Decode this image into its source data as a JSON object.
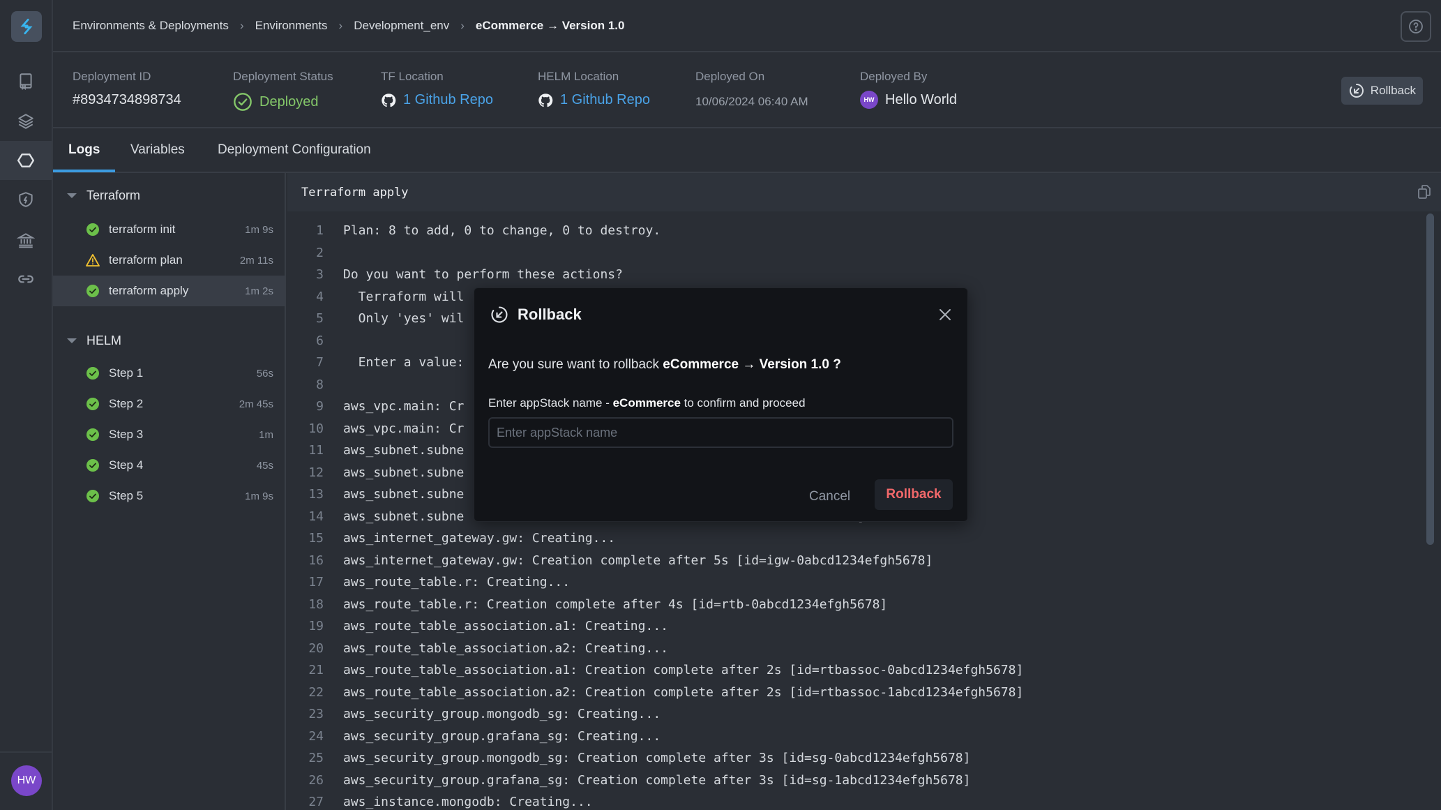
{
  "rail": {
    "items": [
      {
        "name": "book-icon"
      },
      {
        "name": "layers-icon"
      },
      {
        "name": "hexagon-icon",
        "active": true
      },
      {
        "name": "shield-bolt-icon"
      },
      {
        "name": "bank-icon"
      },
      {
        "name": "link-icon"
      }
    ],
    "avatar_initials": "HW"
  },
  "breadcrumb": {
    "items": [
      "Environments & Deployments",
      "Environments",
      "Development_env",
      "eCommerce → Version 1.0"
    ]
  },
  "info": {
    "deployment_id": {
      "label": "Deployment ID",
      "value": "#8934734898734"
    },
    "status": {
      "label": "Deployment Status",
      "value": "Deployed"
    },
    "tf_location": {
      "label": "TF Location",
      "value": "1 Github Repo"
    },
    "helm_location": {
      "label": "HELM Location",
      "value": "1 Github Repo"
    },
    "deployed_on": {
      "label": "Deployed On",
      "value": "10/06/2024 06:40 AM"
    },
    "deployed_by": {
      "label": "Deployed By",
      "value": "Hello World",
      "initials": "HW"
    },
    "rollback_label": "Rollback"
  },
  "tabs": [
    {
      "label": "Logs",
      "active": true
    },
    {
      "label": "Variables"
    },
    {
      "label": "Deployment Configuration"
    }
  ],
  "steps": {
    "terraform": {
      "title": "Terraform",
      "items": [
        {
          "name": "terraform init",
          "duration": "1m 9s",
          "status": "success"
        },
        {
          "name": "terraform plan",
          "duration": "2m 11s",
          "status": "warning"
        },
        {
          "name": "terraform apply",
          "duration": "1m 2s",
          "status": "success",
          "active": true
        }
      ]
    },
    "helm": {
      "title": "HELM",
      "items": [
        {
          "name": "Step 1",
          "duration": "56s",
          "status": "success"
        },
        {
          "name": "Step 2",
          "duration": "2m 45s",
          "status": "success"
        },
        {
          "name": "Step 3",
          "duration": "1m",
          "status": "success"
        },
        {
          "name": "Step 4",
          "duration": "45s",
          "status": "success"
        },
        {
          "name": "Step 5",
          "duration": "1m 9s",
          "status": "success"
        }
      ]
    }
  },
  "log": {
    "title": "Terraform apply",
    "lines": [
      "Plan: 8 to add, 0 to change, 0 to destroy.",
      "",
      "Do you want to perform these actions?",
      "  Terraform will",
      "  Only 'yes' wil",
      "",
      "  Enter a value:",
      "",
      "aws_vpc.main: Cr",
      "aws_vpc.main: Cr",
      "aws_subnet.subne",
      "aws_subnet.subne",
      "aws_subnet.subne",
      "aws_subnet.subne                                                    ]",
      "aws_internet_gateway.gw: Creating...",
      "aws_internet_gateway.gw: Creation complete after 5s [id=igw-0abcd1234efgh5678]",
      "aws_route_table.r: Creating...",
      "aws_route_table.r: Creation complete after 4s [id=rtb-0abcd1234efgh5678]",
      "aws_route_table_association.a1: Creating...",
      "aws_route_table_association.a2: Creating...",
      "aws_route_table_association.a1: Creation complete after 2s [id=rtbassoc-0abcd1234efgh5678]",
      "aws_route_table_association.a2: Creation complete after 2s [id=rtbassoc-1abcd1234efgh5678]",
      "aws_security_group.mongodb_sg: Creating...",
      "aws_security_group.grafana_sg: Creating...",
      "aws_security_group.mongodb_sg: Creation complete after 3s [id=sg-0abcd1234efgh5678]",
      "aws_security_group.grafana_sg: Creation complete after 3s [id=sg-1abcd1234efgh5678]",
      "aws_instance.mongodb: Creating..."
    ]
  },
  "modal": {
    "title": "Rollback",
    "question_prefix": "Are you sure want to rollback ",
    "question_app": "eCommerce",
    "question_arrow": " → Version 1.0 ?",
    "hint_prefix": "Enter appStack name - ",
    "hint_app": "eCommerce",
    "hint_suffix": " to confirm and proceed",
    "input_value": "",
    "input_placeholder": "Enter appStack name",
    "cancel_label": "Cancel",
    "confirm_label": "Rollback"
  },
  "colors": {
    "accent": "#3c9be0",
    "success": "#84c769",
    "warning": "#f2c230",
    "danger": "#f2686a",
    "avatar": "#7a47c9"
  }
}
